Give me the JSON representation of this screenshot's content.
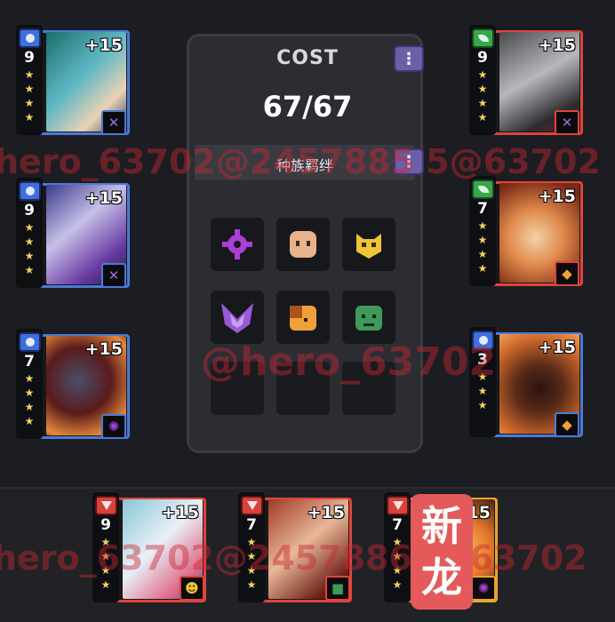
{
  "cost_panel": {
    "title": "COST",
    "value": "67/67",
    "bond_label": "种族羁绊",
    "info_icon": "info-icon",
    "bond_slots": [
      {
        "icon": "flower-gear-icon",
        "color": "#a83fd6"
      },
      {
        "icon": "face-icon",
        "color": "#e8b28c"
      },
      {
        "icon": "gold-mask-icon",
        "color": "#f0c436"
      },
      {
        "icon": "purple-wings-icon",
        "color": "#9a5ad8"
      },
      {
        "icon": "orange-beast-icon",
        "color": "#f0a03a"
      },
      {
        "icon": "green-slime-icon",
        "color": "#3f9a5a"
      }
    ]
  },
  "heroes": [
    {
      "id": "left-1",
      "level": "9",
      "bonus": "+15",
      "rank_icon": "blue-shield-icon",
      "star_count": 4,
      "trait_icon": "purple-wings-icon",
      "trait_icon2": "face-icon",
      "colors": [
        "#1b6e6c",
        "#5fb8c4",
        "#e9d2b4"
      ]
    },
    {
      "id": "left-2",
      "level": "9",
      "bonus": "+15",
      "rank_icon": "blue-shield-icon",
      "star_count": 4,
      "trait_icon": "gold-mask-icon",
      "trait_icon2": "purple-wings-icon",
      "colors": [
        "#3b3b8a",
        "#c6c0e8",
        "#6a3aa2"
      ]
    },
    {
      "id": "left-3",
      "level": "7",
      "bonus": "+15",
      "rank_icon": "blue-shield-icon",
      "star_count": 4,
      "trait_icon": "gold-mask-icon",
      "trait_icon2": "flower-gear-icon",
      "colors": [
        "#5a1a1a",
        "#e88a3c",
        "#4a4f6c"
      ]
    },
    {
      "id": "right-1",
      "level": "9",
      "bonus": "+15",
      "rank_icon": "green-leaf-icon",
      "star_count": 4,
      "trait_icon": "purple-wings-icon",
      "trait_icon2": "face-icon",
      "colors": [
        "#4a4a4e",
        "#b8b8bc",
        "#8a1a1a"
      ]
    },
    {
      "id": "right-2",
      "level": "7",
      "bonus": "+15",
      "rank_icon": "green-leaf-icon",
      "star_count": 4,
      "trait_icon": "orange-beast-icon",
      "trait_icon2": "flower-gear-icon",
      "colors": [
        "#7a2a16",
        "#e0894a",
        "#f2d2a8"
      ]
    },
    {
      "id": "right-3",
      "level": "3",
      "bonus": "+15",
      "rank_icon": "blue-shield-icon",
      "star_count": 3,
      "trait_icon": "orange-beast-icon",
      "trait_icon2": "",
      "colors": [
        "#5a2a18",
        "#d06a2c",
        "#2a1410"
      ]
    },
    {
      "id": "bottom-1",
      "level": "9",
      "bonus": "+15",
      "rank_icon": "red-sword-icon",
      "star_count": 4,
      "trait_icon": "gold-mask-icon",
      "trait_icon2": "",
      "colors": [
        "#8ac6d6",
        "#e8f0f8",
        "#e06a8a"
      ]
    },
    {
      "id": "bottom-2",
      "level": "7",
      "bonus": "+15",
      "rank_icon": "red-sword-icon",
      "star_count": 4,
      "trait_icon": "green-slime-icon",
      "trait_icon2": "flower-gear-icon",
      "colors": [
        "#a03a28",
        "#e8b898",
        "#6a1a14"
      ]
    },
    {
      "id": "bottom-3",
      "level": "7",
      "bonus": "15",
      "rank_icon": "red-sword-icon",
      "star_count": 4,
      "trait_icon": "flower-gear-icon",
      "trait_icon2": "",
      "colors": [
        "#3a1a10",
        "#e87a2c",
        "#f0c05a"
      ]
    }
  ],
  "watermarks": {
    "line1": "hero_63702@2457885 5@63702",
    "line2": "@hero_63702",
    "line3": "hero_63702@24578865@63702",
    "badge_top": "新",
    "badge_bottom": "龙"
  }
}
